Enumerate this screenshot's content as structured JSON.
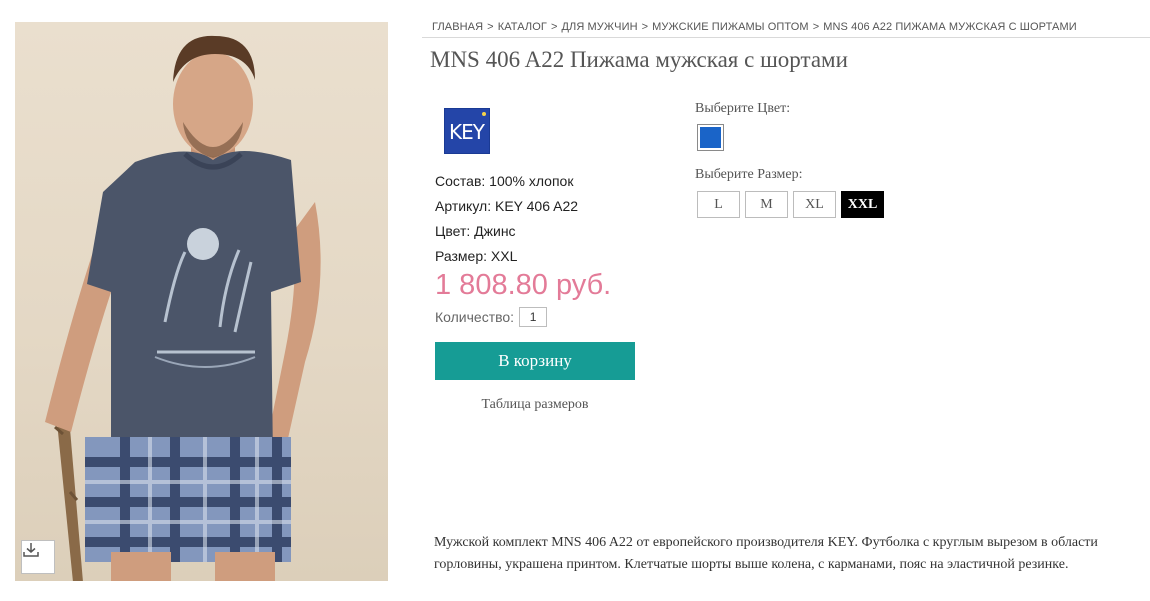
{
  "breadcrumb": {
    "items": [
      "ГЛАВНАЯ",
      "КАТАЛОГ",
      "ДЛЯ МУЖЧИН",
      "МУЖСКИЕ ПИЖАМЫ ОПТОМ",
      "MNS 406 A22 ПИЖАМА МУЖСКАЯ С ШОРТАМИ"
    ],
    "separator": ">"
  },
  "product": {
    "title": "MNS 406 A22 Пижама мужская с шортами",
    "brand_logo_text": "KEY",
    "specs": [
      {
        "label": "Состав:",
        "value": "100% хлопок"
      },
      {
        "label": "Артикул:",
        "value": "KEY 406 A22"
      },
      {
        "label": "Цвет:",
        "value": "Джинс"
      },
      {
        "label": "Размер:",
        "value": "XXL"
      }
    ],
    "price": "1 808.80 руб.",
    "quantity_label": "Количество:",
    "quantity_value": "1",
    "add_to_cart": "В корзину",
    "size_table_link": "Таблица размеров",
    "description": "Мужской комплект MNS 406 A22 от европейского производителя KEY. Футболка с круглым вырезом в области горловины, украшена принтом. Клетчатые шорты выше колена, с карманами, пояс на эластичной резинке."
  },
  "options": {
    "color_label": "Выберите Цвет:",
    "color_swatch": "#1a64c8",
    "size_label": "Выберите Размер:",
    "sizes": [
      "L",
      "M",
      "XL",
      "XXL"
    ],
    "selected_size": "XXL"
  },
  "icons": {
    "download": "download-icon"
  },
  "colors": {
    "price": "#e37b98",
    "cart_button": "#169c95",
    "selected_size_bg": "#000000"
  }
}
